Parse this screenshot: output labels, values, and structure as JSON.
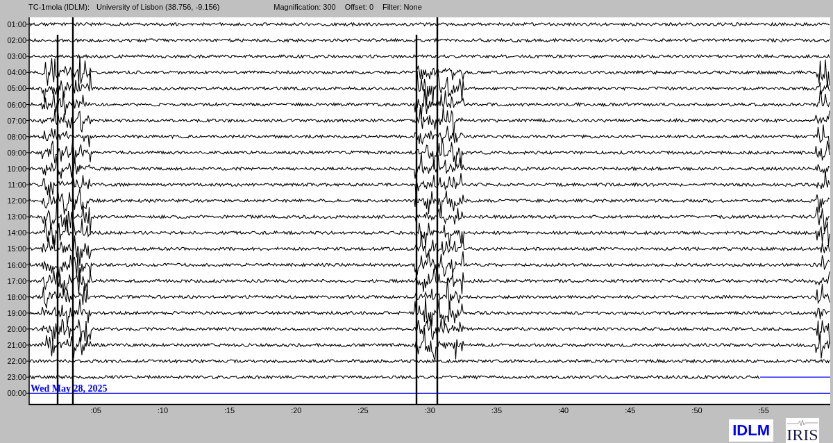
{
  "header": {
    "station": "TC-1mola (IDLM):",
    "location": "University of Lisbon (38.756, -9.156)",
    "magnification": "Magnification: 300",
    "offset": "Offset: 0",
    "filter": "Filter: None"
  },
  "rows": [
    "01:00",
    "02:00",
    "03:00",
    "04:00",
    "05:00",
    "06:00",
    "07:00",
    "08:00",
    "09:00",
    "10:00",
    "11:00",
    "12:00",
    "13:00",
    "14:00",
    "15:00",
    "16:00",
    "17:00",
    "18:00",
    "19:00",
    "20:00",
    "21:00",
    "22:00",
    "23:00",
    "00:00"
  ],
  "date_label": "Wed May 28, 2025",
  "x_ticks": [
    ":05",
    ":10",
    ":15",
    ":20",
    ":25",
    ":30",
    ":35",
    ":40",
    ":45",
    ":50",
    ":55"
  ],
  "footer": {
    "station_code": "IDLM",
    "logo": "IRIS"
  }
}
